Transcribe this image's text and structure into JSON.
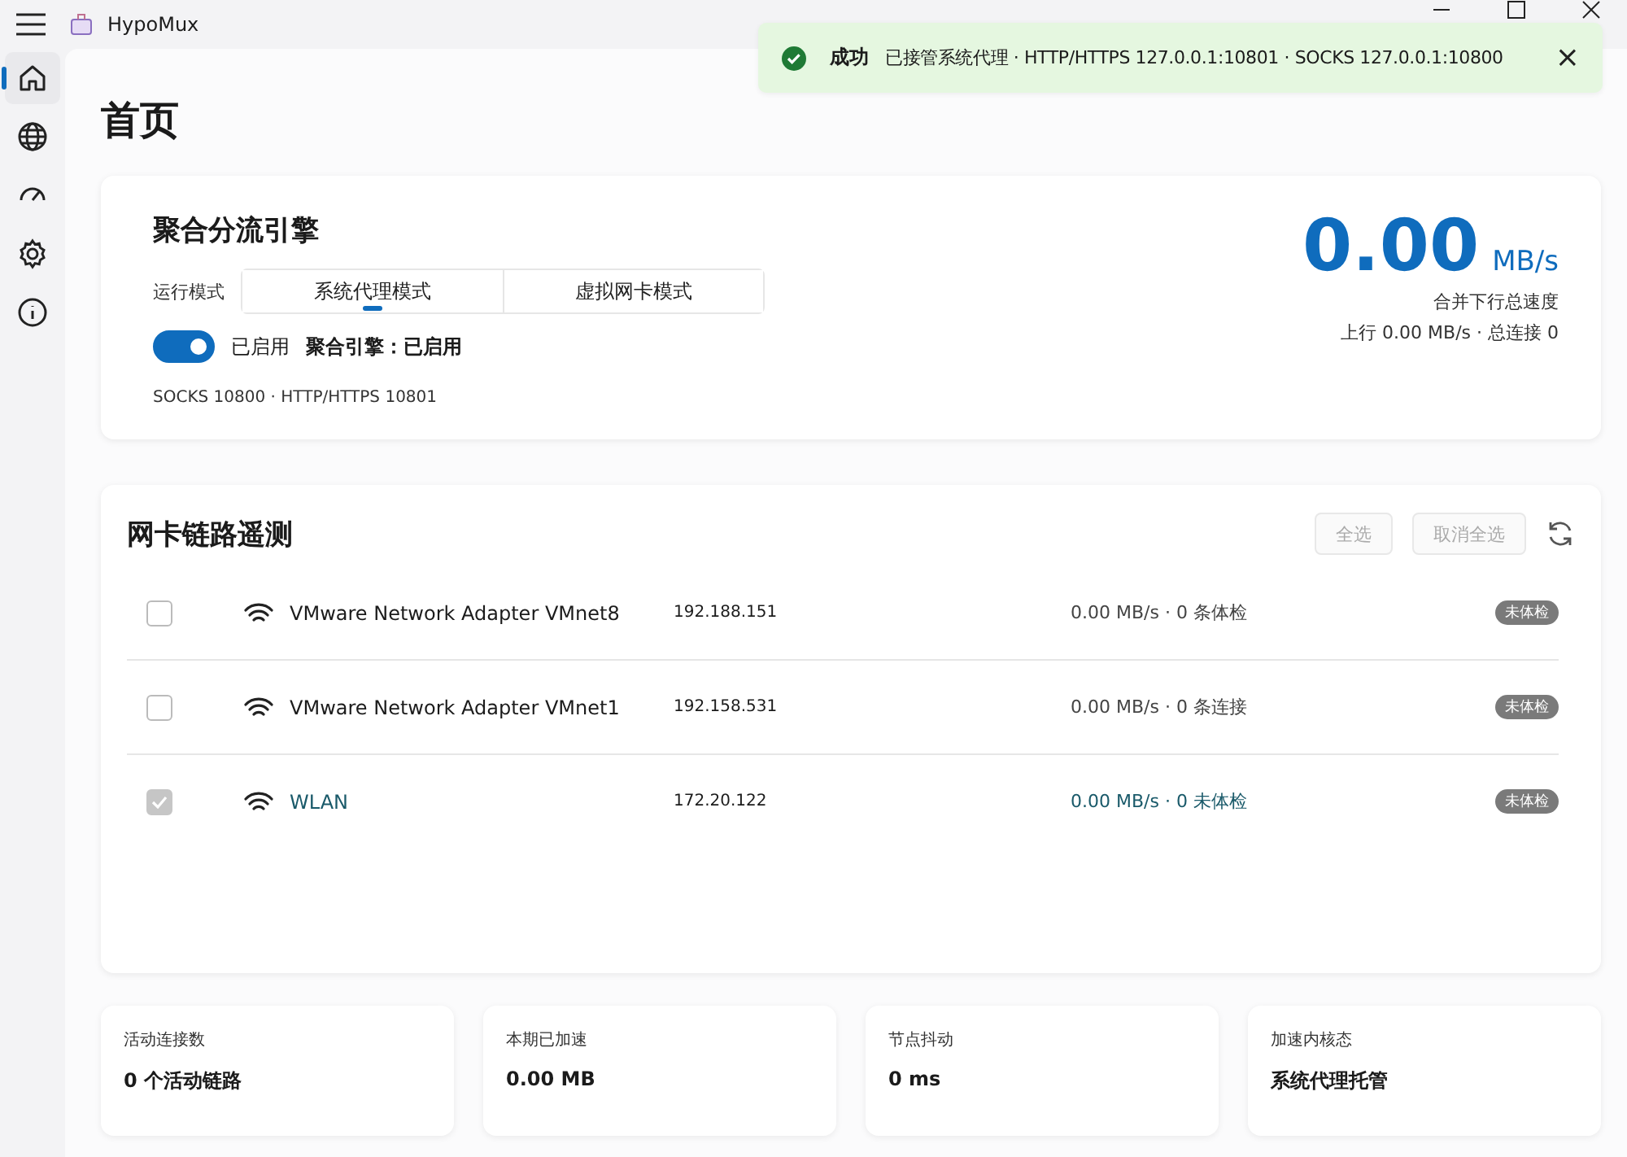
{
  "window": {
    "title": "HypoMux"
  },
  "sidebar": {
    "items": [
      {
        "kind": "home",
        "selected": true
      },
      {
        "kind": "globe",
        "selected": false
      },
      {
        "kind": "gauge",
        "selected": false
      },
      {
        "kind": "settings",
        "selected": false
      },
      {
        "kind": "info",
        "selected": false
      }
    ]
  },
  "toast": {
    "title": "成功",
    "message": "已接管系统代理 · HTTP/HTTPS 127.0.0.1:10801 · SOCKS 127.0.0.1:10800",
    "close": "×"
  },
  "page_title": "首页",
  "engine": {
    "title": "聚合分流引擎",
    "mode_label": "运行模式",
    "modes": [
      {
        "label": "系统代理模式",
        "selected": true
      },
      {
        "label": "虚拟网卡模式",
        "selected": false
      }
    ],
    "toggle": {
      "on": true,
      "label": "已启用"
    },
    "status": "聚合引擎：已启用",
    "ports": "SOCKS 10800 · HTTP/HTTPS 10801",
    "speed": "0.00",
    "unit": "MB/s",
    "speed_caption": "合并下行总速度",
    "speed_detail": "上行 0.00 MB/s · 总连接 0"
  },
  "adapters": {
    "title": "网卡链路遥测",
    "buttons": [
      {
        "label": "全选",
        "disabled": true
      },
      {
        "label": "取消全选",
        "disabled": true
      }
    ],
    "rows": [
      {
        "name": "VMware Network Adapter VMnet8",
        "ip": "192.188.151",
        "stats": "0.00 MB/s · 0 条体检",
        "badge": "未体检",
        "checked": false,
        "disabled": false
      },
      {
        "name": "VMware Network Adapter VMnet1",
        "ip": "192.158.531",
        "stats": "0.00 MB/s · 0 条连接",
        "badge": "未体检",
        "checked": false,
        "disabled": false
      },
      {
        "name": "WLAN",
        "ip": "172.20.122",
        "stats": "0.00 MB/s · 0 未体检",
        "badge": "未体检",
        "checked": true,
        "disabled": true
      }
    ]
  },
  "stats": [
    {
      "label": "活动连接数",
      "value": "0 个活动链路"
    },
    {
      "label": "本期已加速",
      "value": "0.00 MB"
    },
    {
      "label": "节点抖动",
      "value": "0 ms"
    },
    {
      "label": "加速内核态",
      "value": "系统代理托管"
    }
  ]
}
